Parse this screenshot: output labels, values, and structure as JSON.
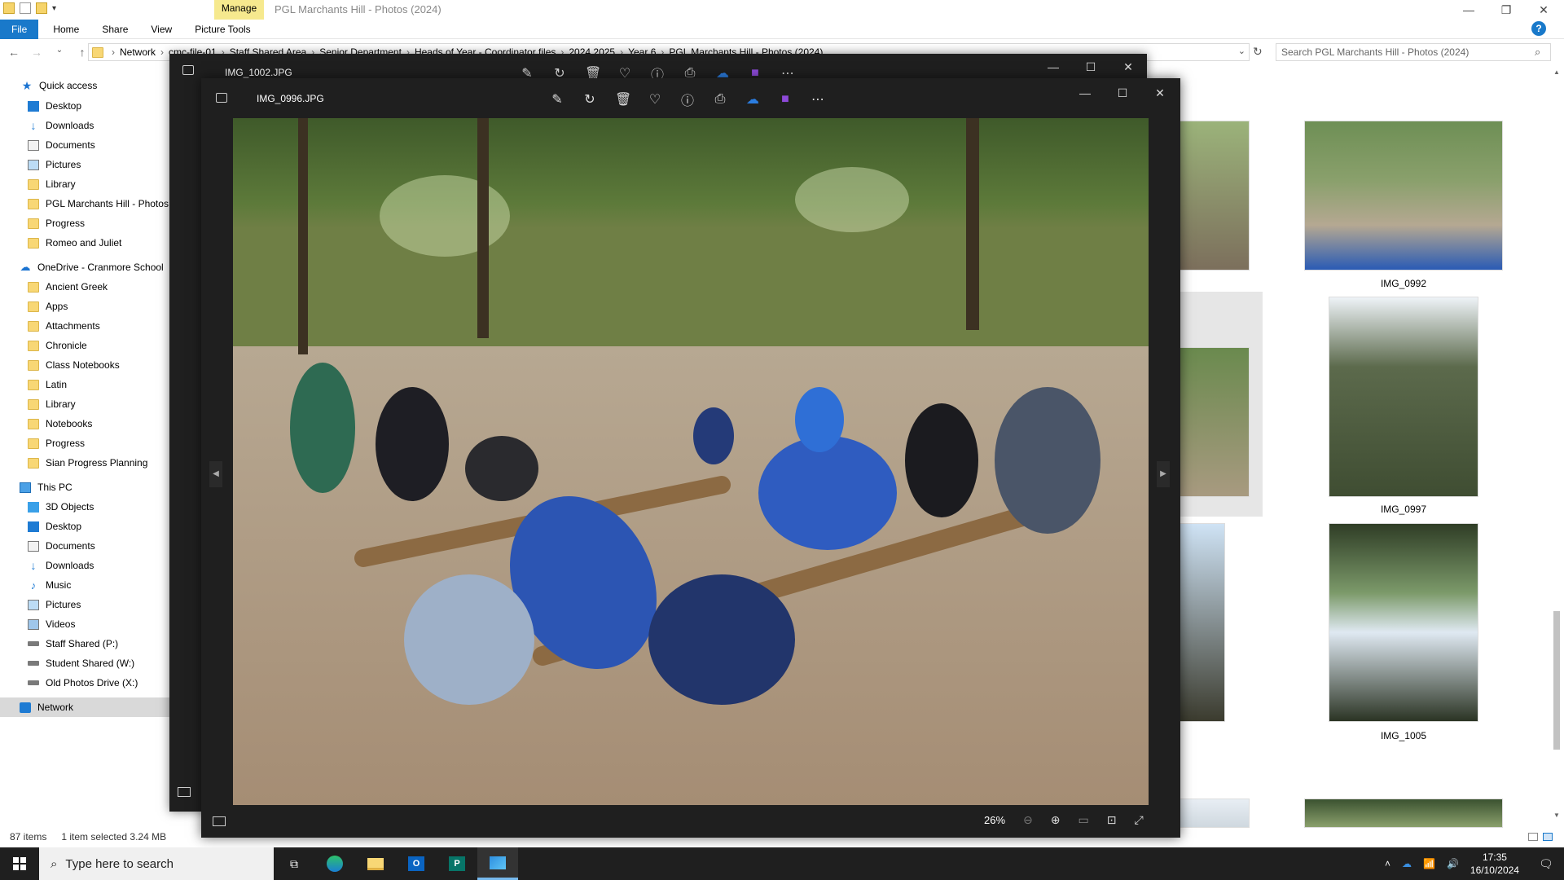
{
  "explorer": {
    "manage_tab": "Manage",
    "title": "PGL Marchants Hill - Photos (2024)",
    "ribbon_tabs": [
      "File",
      "Home",
      "Share",
      "View",
      "Picture Tools"
    ],
    "breadcrumbs": [
      "Network",
      "cmc-file-01",
      "Staff Shared Area",
      "Senior Department",
      "Heads of Year - Coordinator files",
      "2024 2025",
      "Year 6",
      "PGL Marchants Hill - Photos (2024)"
    ],
    "search_placeholder": "Search PGL Marchants Hill - Photos (2024)",
    "status_items": "87 items",
    "status_selected": "1 item selected  3.24 MB"
  },
  "nav": {
    "quick_access": "Quick access",
    "quick_items": [
      "Desktop",
      "Downloads",
      "Documents",
      "Pictures",
      "Library",
      "PGL Marchants Hill - Photos (",
      "Progress",
      "Romeo and Juliet"
    ],
    "onedrive": "OneDrive - Cranmore School",
    "onedrive_items": [
      "Ancient Greek",
      "Apps",
      "Attachments",
      "Chronicle",
      "Class Notebooks",
      "Latin",
      "Library",
      "Notebooks",
      "Progress",
      "Sian Progress Planning"
    ],
    "this_pc": "This PC",
    "pc_items": [
      "3D Objects",
      "Desktop",
      "Documents",
      "Downloads",
      "Music",
      "Pictures",
      "Videos",
      "Staff Shared (P:)",
      "Student Shared (W:)",
      "Old Photos Drive (X:)"
    ],
    "network": "Network"
  },
  "files": [
    "IMG_0992",
    "IMG_0997",
    "IMG_1005"
  ],
  "photos_back": {
    "filename": "IMG_1002.JPG"
  },
  "photos_front": {
    "filename": "IMG_0996.JPG",
    "zoom": "26%"
  },
  "taskbar": {
    "search_placeholder": "Type here to search",
    "time": "17:35",
    "date": "16/10/2024"
  },
  "colors": {
    "accent": "#1979ca",
    "manage": "#f6e98e",
    "photos_bg": "#1f1f1f"
  }
}
